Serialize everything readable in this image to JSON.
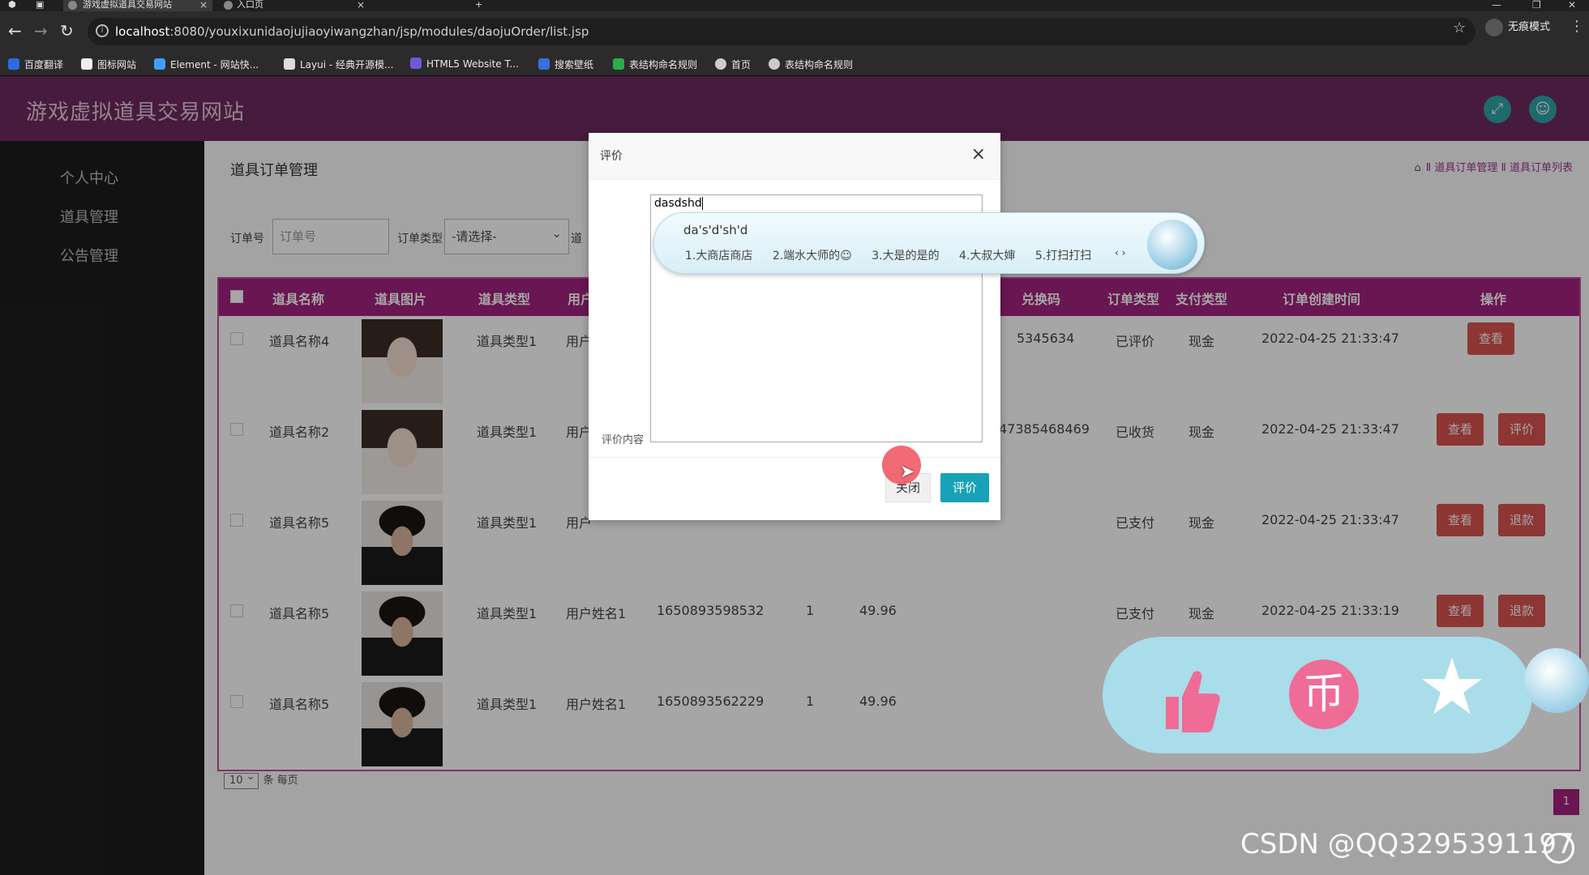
{
  "browser": {
    "tabs": [
      {
        "title": "游戏虚拟道具交易网站",
        "active": true
      },
      {
        "title": "入口页",
        "active": false
      }
    ],
    "new_tab": "+",
    "url_host": "localhost",
    "url_rest": ":8080/youxixunidaojujiaoyiwangzhan/jsp/modules/daojuOrder/list.jsp",
    "profile": "无痕模式",
    "bookmarks": [
      "百度翻译",
      "图标网站",
      "Element - 网站快...",
      "Layui - 经典开源模...",
      "HTML5 Website T...",
      "搜索壁纸",
      "表结构命名规则",
      "首页",
      "表结构命名规则"
    ]
  },
  "app": {
    "title": "游戏虚拟道具交易网站",
    "sidebar": [
      "个人中心",
      "道具管理",
      "公告管理"
    ],
    "page_title": "道具订单管理",
    "breadcrumb": "Ⅱ 道具订单管理 Ⅱ 道具订单列表",
    "search": {
      "order_no_label": "订单号",
      "order_no_placeholder": "订单号",
      "order_type_label": "订单类型",
      "order_type_value": "-请选择-",
      "truncated_label": "道"
    },
    "table": {
      "headers": [
        "道具名称",
        "道具图片",
        "道具类型",
        "用户",
        "兑换码",
        "订单类型",
        "支付类型",
        "订单创建时间",
        "操作"
      ],
      "rows": [
        {
          "name": "道具名称4",
          "photo": "woman",
          "type": "道具类型1",
          "user": "用户",
          "order_no": "",
          "qty": "",
          "price": "",
          "code": "5345634",
          "status": "已评价",
          "pay": "现金",
          "time": "2022-04-25 21:33:47",
          "actions": [
            "查看"
          ]
        },
        {
          "name": "道具名称2",
          "photo": "woman",
          "type": "道具类型1",
          "user": "用户",
          "order_no": "",
          "qty": "",
          "price": "",
          "code": "47385468469",
          "status": "已收货",
          "pay": "现金",
          "time": "2022-04-25 21:33:47",
          "actions": [
            "查看",
            "评价"
          ]
        },
        {
          "name": "道具名称5",
          "photo": "man",
          "type": "道具类型1",
          "user": "用户",
          "order_no": "",
          "qty": "",
          "price": "",
          "code": "",
          "status": "已支付",
          "pay": "现金",
          "time": "2022-04-25 21:33:47",
          "actions": [
            "查看",
            "退款"
          ]
        },
        {
          "name": "道具名称5",
          "photo": "man",
          "type": "道具类型1",
          "user": "用户姓名1",
          "order_no": "1650893598532",
          "qty": "1",
          "price": "49.96",
          "code": "",
          "status": "已支付",
          "pay": "现金",
          "time": "2022-04-25 21:33:19",
          "actions": [
            "查看",
            "退款"
          ]
        },
        {
          "name": "道具名称5",
          "photo": "man",
          "type": "道具类型1",
          "user": "用户姓名1",
          "order_no": "1650893562229",
          "qty": "1",
          "price": "49.96",
          "code": "",
          "status": "",
          "pay": "",
          "time": "",
          "actions": []
        }
      ]
    },
    "pager": {
      "page_size": "10",
      "page_size_suffix": "条 每页",
      "current_page": "1"
    }
  },
  "modal": {
    "title": "评价",
    "field_label": "评价内容",
    "textarea_value": "dasdshd",
    "close_label": "关闭",
    "submit_label": "评价"
  },
  "ime": {
    "pinyin": "da's'd'sh'd",
    "candidates": [
      "1.大商店商店",
      "2.端水大师的☺",
      "3.大是的是的",
      "4.大叔大婶",
      "5.打扫打扫"
    ],
    "arrows": "‹ ›"
  },
  "watermark": "CSDN @QQ3295391197",
  "colors": {
    "header": "#6c2a5e",
    "table_header": "#a2227f",
    "danger": "#d9534f",
    "primary": "#17a2b8",
    "pill": "#a8dde9",
    "coin": "#ef6c97"
  }
}
